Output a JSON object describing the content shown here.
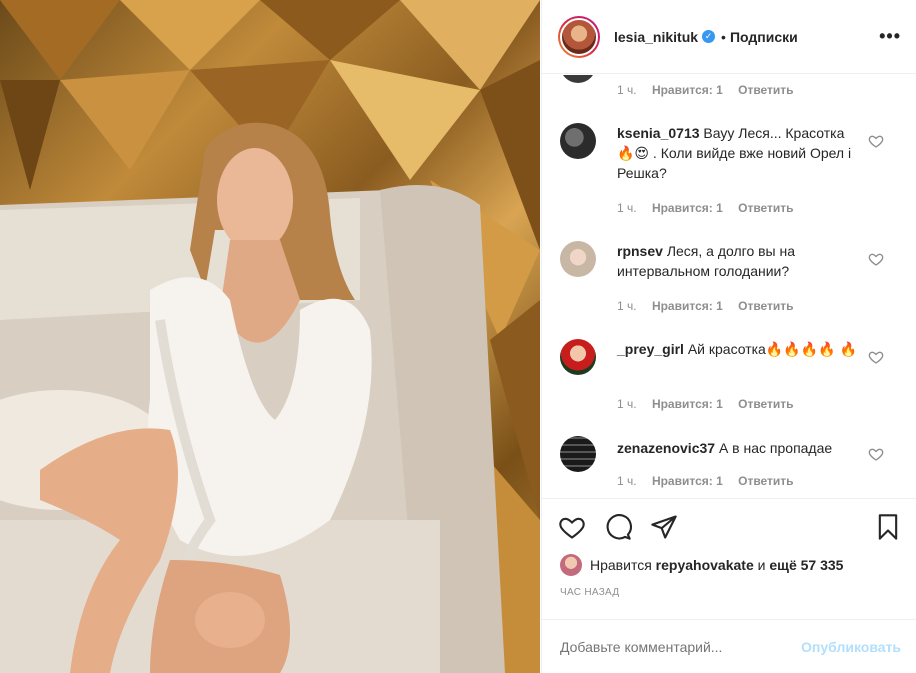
{
  "header": {
    "username": "lesia_nikituk",
    "verified_mark": "✓",
    "separator": "•",
    "follow_label": "Подписки",
    "more_label": "•••"
  },
  "comments": [
    {
      "username": "",
      "text": "",
      "time": "1 ч.",
      "likes": "Нравится: 1",
      "reply": "Ответить"
    },
    {
      "username": "ksenia_0713",
      "text": "Вауу Леся... Красотка🔥😍 . Коли вийде вже новий Орел і Решка?",
      "time": "1 ч.",
      "likes": "Нравится: 1",
      "reply": "Ответить"
    },
    {
      "username": "rpnsev",
      "text": "Леся, а долго вы на интервальном голодании?",
      "time": "1 ч.",
      "likes": "Нравится: 1",
      "reply": "Ответить"
    },
    {
      "username": "_prey_girl",
      "text": "Ай красотка🔥🔥🔥🔥 🔥",
      "time": "1 ч.",
      "likes": "Нравится: 1",
      "reply": "Ответить"
    },
    {
      "username": "zenazenovic37",
      "text": "А в нас пропадае",
      "time": "1 ч.",
      "likes": "Нравится: 1",
      "reply": "Ответить"
    }
  ],
  "actions": {
    "like_icon": "heart-icon",
    "comment_icon": "comment-icon",
    "share_icon": "share-icon",
    "save_icon": "bookmark-icon"
  },
  "likes": {
    "prefix": "Нравится",
    "user": "repyahovakate",
    "conjunction": "и",
    "others": "ещё 57 335"
  },
  "timestamp": "ЧАС НАЗАД",
  "add_comment": {
    "placeholder": "Добавьте комментарий...",
    "publish_label": "Опубликовать"
  },
  "colors": {
    "text": "#262626",
    "muted": "#8e8e8e",
    "link_disabled": "#b2dffc",
    "verified": "#3897f0"
  }
}
